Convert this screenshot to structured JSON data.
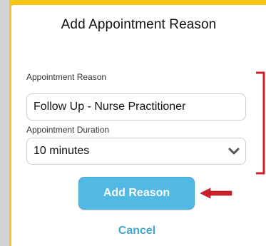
{
  "dialog": {
    "title": "Add Appointment Reason",
    "reason_label": "Appointment Reason",
    "reason_value": "Follow Up - Nurse Practitioner",
    "duration_label": "Appointment Duration",
    "duration_value": "10 minutes",
    "add_button_label": "Add Reason",
    "cancel_label": "Cancel"
  },
  "colors": {
    "accent": "#52b9e4",
    "cancel_text": "#3fa7cf",
    "annotation": "#d0202a",
    "frame_border": "#f5c518"
  },
  "icons": {
    "duration_dropdown": "chevron-down-icon",
    "annotation_arrow": "arrow-left-icon",
    "annotation_bracket": "bracket-icon"
  }
}
